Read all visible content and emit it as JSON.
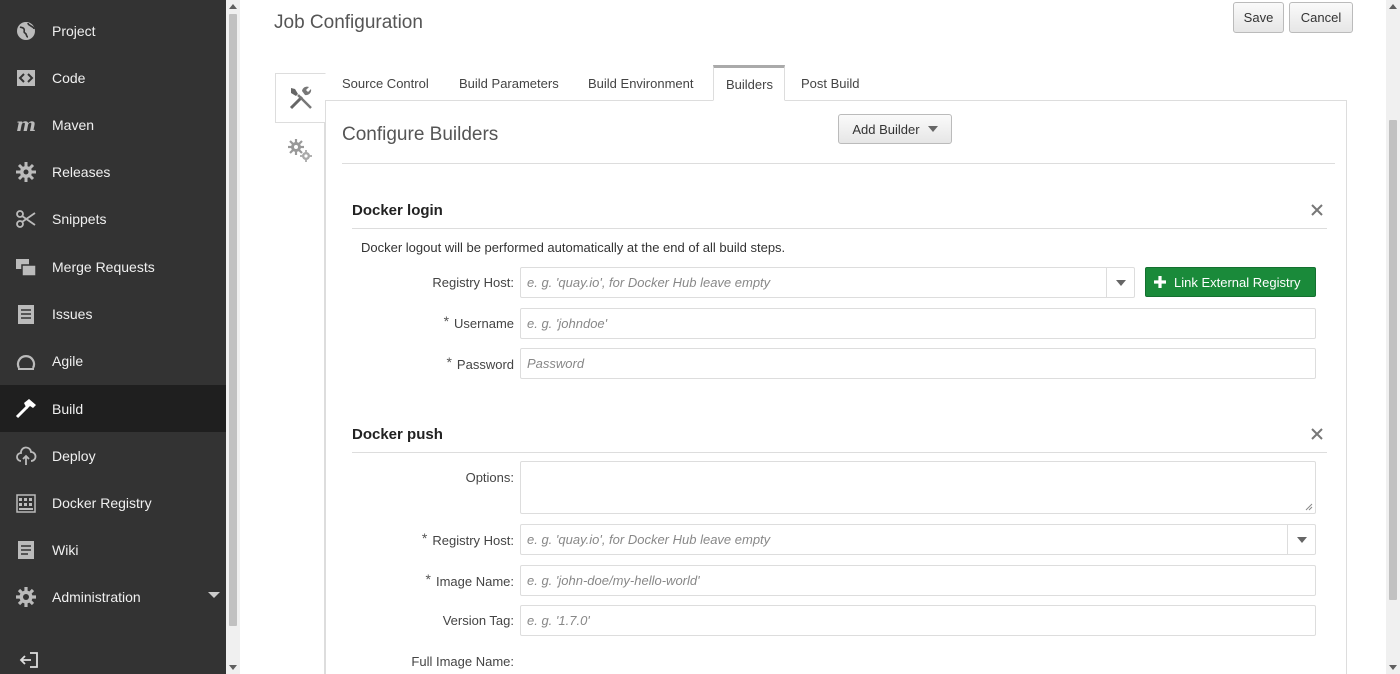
{
  "sidebar": {
    "items": [
      {
        "label": "Project",
        "icon": "globe-icon"
      },
      {
        "label": "Code",
        "icon": "code-icon"
      },
      {
        "label": "Maven",
        "icon": "maven-icon"
      },
      {
        "label": "Releases",
        "icon": "gear-icon"
      },
      {
        "label": "Snippets",
        "icon": "scissors-icon"
      },
      {
        "label": "Merge Requests",
        "icon": "merge-request-icon"
      },
      {
        "label": "Issues",
        "icon": "clipboard-icon"
      },
      {
        "label": "Agile",
        "icon": "agile-icon"
      },
      {
        "label": "Build",
        "icon": "hammer-icon",
        "active": true
      },
      {
        "label": "Deploy",
        "icon": "cloud-upload-icon"
      },
      {
        "label": "Docker Registry",
        "icon": "docker-registry-icon"
      },
      {
        "label": "Wiki",
        "icon": "wiki-icon"
      },
      {
        "label": "Administration",
        "icon": "admin-gear-icon",
        "has_dropdown": true
      }
    ],
    "logout_icon": "logout-icon"
  },
  "header": {
    "title": "Job Configuration",
    "save_label": "Save",
    "cancel_label": "Cancel"
  },
  "vertical_tabs": [
    {
      "icon": "tools-icon",
      "active": true
    },
    {
      "icon": "gears-icon",
      "active": false
    }
  ],
  "tabs": [
    {
      "label": "Source Control"
    },
    {
      "label": "Build Parameters"
    },
    {
      "label": "Build Environment"
    },
    {
      "label": "Builders",
      "active": true
    },
    {
      "label": "Post Build"
    }
  ],
  "main": {
    "section_title": "Configure Builders",
    "add_builder_label": "Add Builder"
  },
  "docker_login": {
    "title": "Docker login",
    "description": "Docker logout will be performed automatically at the end of all build steps.",
    "registry_host_label": "Registry Host:",
    "registry_host_placeholder": "e. g. 'quay.io', for Docker Hub leave empty",
    "link_registry_label": "Link External Registry",
    "username_label": "Username",
    "username_placeholder": "e. g. 'johndoe'",
    "password_label": "Password",
    "password_placeholder": "Password",
    "required_mark": "*"
  },
  "docker_push": {
    "title": "Docker push",
    "options_label": "Options:",
    "registry_host_label": "Registry Host:",
    "registry_host_placeholder": "e. g. 'quay.io', for Docker Hub leave empty",
    "image_name_label": "Image Name:",
    "image_name_placeholder": "e. g. 'john-doe/my-hello-world'",
    "version_tag_label": "Version Tag:",
    "version_tag_placeholder": "e. g. '1.7.0'",
    "full_image_name_label": "Full Image Name:",
    "required_mark": "*"
  },
  "colors": {
    "sidebar_bg": "#333333",
    "sidebar_active_bg": "#1f1f1f",
    "primary_button": "#1a8a3a"
  }
}
